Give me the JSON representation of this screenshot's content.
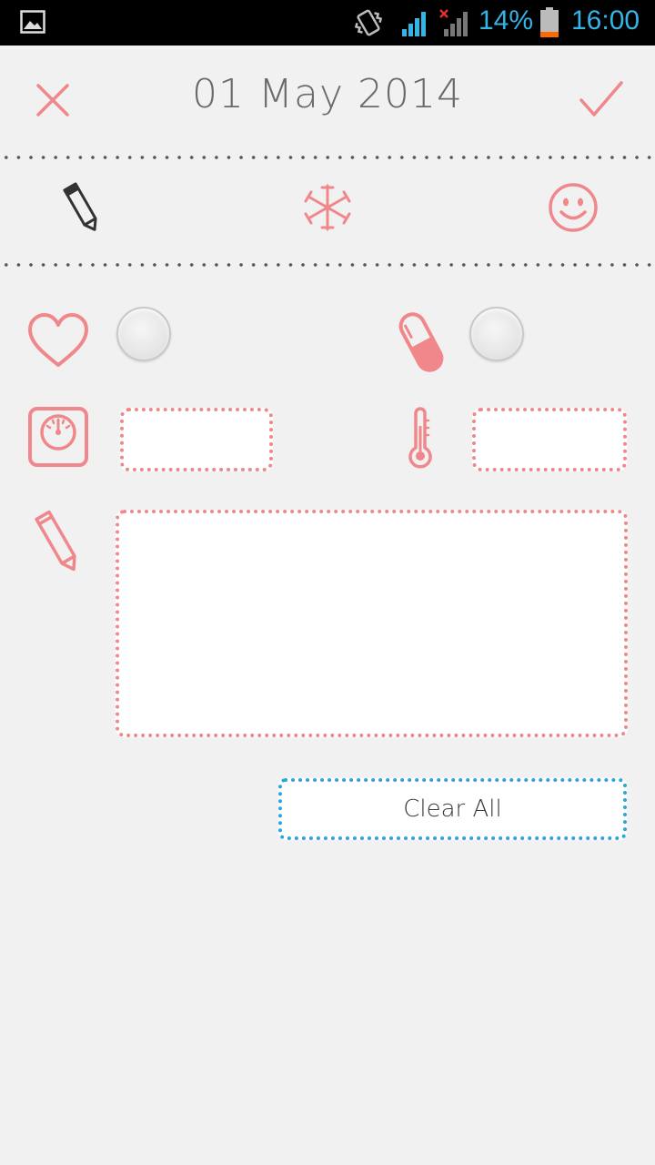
{
  "status_bar": {
    "battery_percent": "14%",
    "time": "16:00",
    "icons": [
      "gallery-icon",
      "vibrate-icon",
      "signal-icon",
      "signal-no-data-icon",
      "battery-icon"
    ],
    "accent_color": "#33b5e5"
  },
  "header": {
    "date": "01 May 2014",
    "close_icon": "close-icon",
    "confirm_icon": "check-icon",
    "accent_color": "#f0878a"
  },
  "tabs": [
    {
      "name": "note",
      "icon": "pencil-icon",
      "selected": true
    },
    {
      "name": "symptoms",
      "icon": "asterisk-icon",
      "selected": false
    },
    {
      "name": "mood",
      "icon": "smiley-icon",
      "selected": false
    }
  ],
  "form": {
    "intercourse": {
      "icon": "heart-icon",
      "checked": false
    },
    "pill": {
      "icon": "pill-icon",
      "checked": false
    },
    "weight": {
      "icon": "scale-icon",
      "value": ""
    },
    "temperature": {
      "icon": "thermometer-icon",
      "value": ""
    },
    "note": {
      "icon": "pencil-icon",
      "value": ""
    }
  },
  "clear_all_label": "Clear All"
}
